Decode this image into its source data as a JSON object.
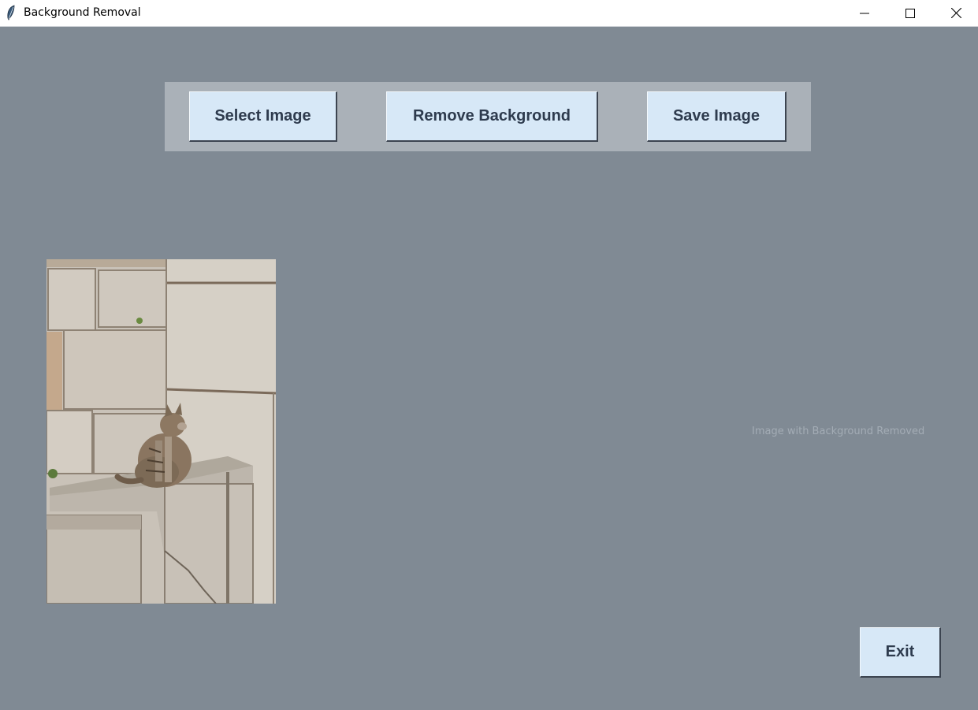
{
  "window": {
    "title": "Background Removal",
    "icon": "feather-icon",
    "controls": [
      "minimize-icon",
      "maximize-icon",
      "close-icon"
    ]
  },
  "toolbar": {
    "select_label": "Select Image",
    "remove_label": "Remove Background",
    "save_label": "Save Image"
  },
  "content": {
    "original_image": "photo of a tabby cat sitting on a stone block",
    "result_label": "Image with Background Removed"
  },
  "footer": {
    "exit_label": "Exit"
  },
  "colors": {
    "background": "#808a94",
    "toolbar": "#aab1b8",
    "button": "#d7e8f7",
    "button_text": "#2e3b4e"
  }
}
